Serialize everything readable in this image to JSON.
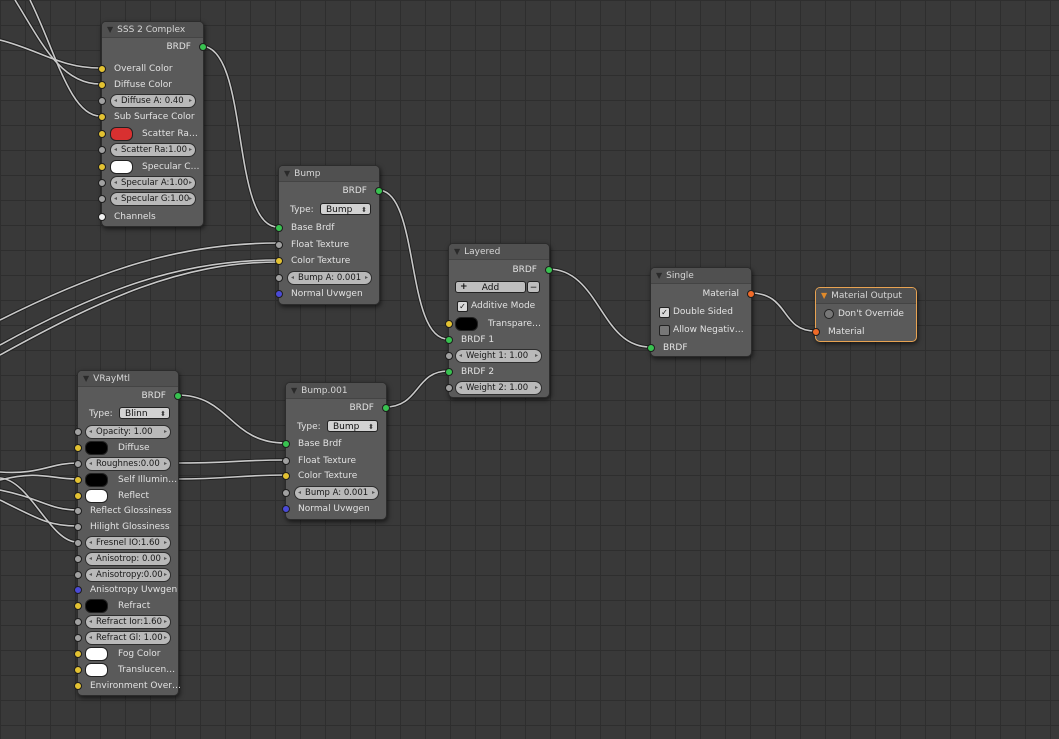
{
  "nodes": {
    "sss": {
      "title": "SSS 2 Complex",
      "output": "BRDF",
      "overall_color": "Overall Color",
      "diffuse_color": "Diffuse Color",
      "diffuse_amount": "Diffuse A: 0.40",
      "sub_surface_color": "Sub Surface Color",
      "scatter_radius_color": "Scatter Ra…",
      "scatter_radius": "Scatter Ra:1.00",
      "specular_color": "Specular C…",
      "specular_amount": "Specular A:1.00",
      "specular_glossiness": "Specular G:1.00",
      "channels": "Channels"
    },
    "bump1": {
      "title": "Bump",
      "output": "BRDF",
      "type_label": "Type:",
      "type_value": "Bump",
      "base_brdf": "Base Brdf",
      "float_texture": "Float Texture",
      "color_texture": "Color Texture",
      "bump_amount": "Bump A:  0.001",
      "normal_uvwgen": "Normal Uvwgen"
    },
    "layered": {
      "title": "Layered",
      "output": "BRDF",
      "add_label": "Add",
      "additive_mode": "Additive Mode",
      "transparency": "Transpare…",
      "brdf1": "BRDF 1",
      "weight1": "Weight 1:   1.00",
      "brdf2": "BRDF 2",
      "weight2": "Weight 2:   1.00"
    },
    "single": {
      "title": "Single",
      "output": "Material",
      "double_sided": "Double Sided",
      "allow_negative": "Allow Negativ…",
      "brdf": "BRDF"
    },
    "material_output": {
      "title": "Material Output",
      "dont_override": "Don't Override",
      "material": "Material"
    },
    "vray": {
      "title": "VRayMtl",
      "output": "BRDF",
      "type_label": "Type:",
      "type_value": "Blinn",
      "opacity": "Opacity:      1.00",
      "diffuse": "Diffuse",
      "roughness": "Roughnes:0.00",
      "self_illumination": "Self Illumin…",
      "reflect": "Reflect",
      "reflect_glossiness": "Reflect Glossiness",
      "hilight_glossiness": "Hilight Glossiness",
      "fresnel_ior": "Fresnel IO:1.60",
      "anisotropy": "Anisotrop: 0.00",
      "anisotropy_rotation": "Anisotropy:0.00",
      "anisotropy_uvwgen": "Anisotropy Uvwgen",
      "refract": "Refract",
      "refract_ior": "Refract Ior:1.60",
      "refract_glossiness": "Refract Gl: 1.00",
      "fog_color": "Fog Color",
      "translucency": "Translucen…",
      "environment_override": "Environment Over…"
    },
    "bump2": {
      "title": "Bump.001",
      "output": "BRDF",
      "type_label": "Type:",
      "type_value": "Bump",
      "base_brdf": "Base Brdf",
      "float_texture": "Float Texture",
      "color_texture": "Color Texture",
      "bump_amount": "Bump A:  0.001",
      "normal_uvwgen": "Normal Uvwgen"
    }
  },
  "colors": {
    "background": "#393939",
    "node_body": "#5a5a5a",
    "socket_color": "#e3c232",
    "socket_brdf": "#38c250",
    "socket_float": "#a1a1a1",
    "socket_vector": "#4a4ad6",
    "socket_material": "#f06a28",
    "scatter_swatch": "#d83030",
    "white_swatch": "#ffffff",
    "black_swatch": "#000000",
    "active_node_border": "#e8a352"
  }
}
